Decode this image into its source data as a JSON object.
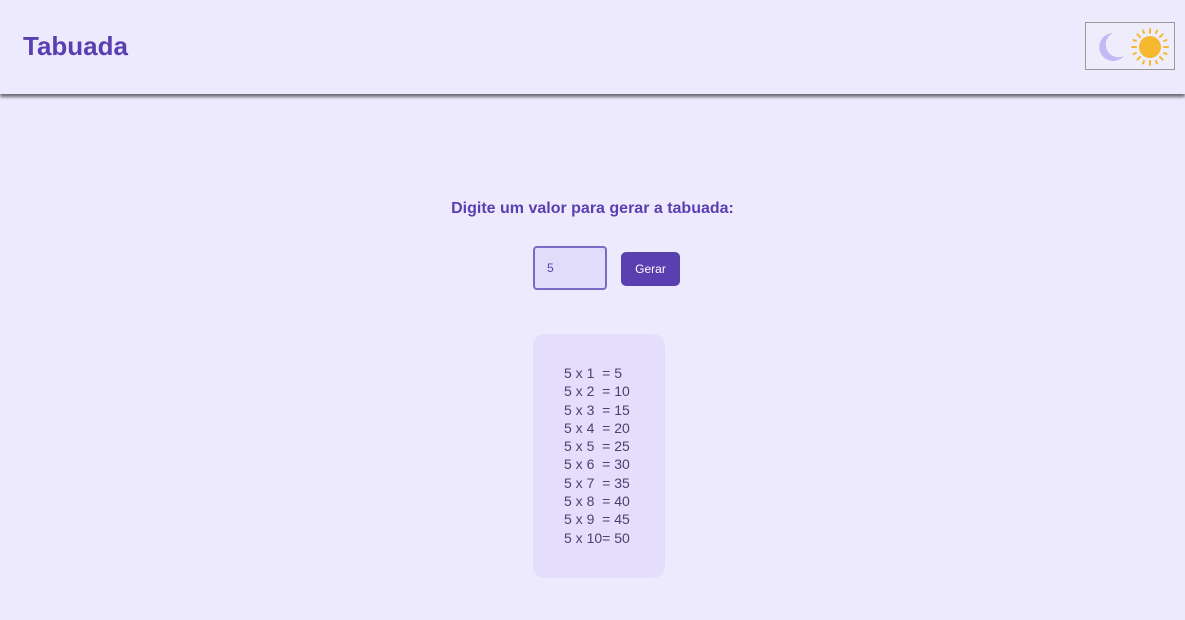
{
  "header": {
    "title": "Tabuada",
    "theme_toggle": {
      "icons": [
        "moon-icon",
        "sun-icon"
      ],
      "moon_color": "#c4b8f5",
      "sun_color": "#f5b82e"
    }
  },
  "main": {
    "prompt": "Digite um valor para gerar a tabuada:",
    "input_value": "5",
    "generate_label": "Gerar",
    "results": [
      "5 x 1  = 5",
      "5 x 2  = 10",
      "5 x 3  = 15",
      "5 x 4  = 20",
      "5 x 5  = 25",
      "5 x 6  = 30",
      "5 x 7  = 35",
      "5 x 8  = 40",
      "5 x 9  = 45",
      "5 x 10= 50"
    ]
  },
  "colors": {
    "accent": "#5a3fb0",
    "background": "#edeafd",
    "result_background": "#e4defc"
  }
}
